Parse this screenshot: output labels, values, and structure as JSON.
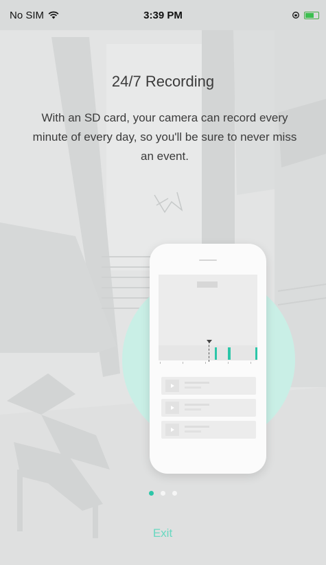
{
  "status_bar": {
    "carrier": "No SIM",
    "time": "3:39 PM"
  },
  "onboarding": {
    "title": "24/7 Recording",
    "description": "With an SD card, your camera can record every minute of every day, so you'll be sure to never miss an event.",
    "page_count": 3,
    "active_page": 1
  },
  "actions": {
    "exit_label": "Exit"
  },
  "colors": {
    "accent": "#2cc6a8",
    "accent_light": "#c9efe6",
    "exit_text": "#69d8c1",
    "text_dark": "#3b3b3b"
  }
}
